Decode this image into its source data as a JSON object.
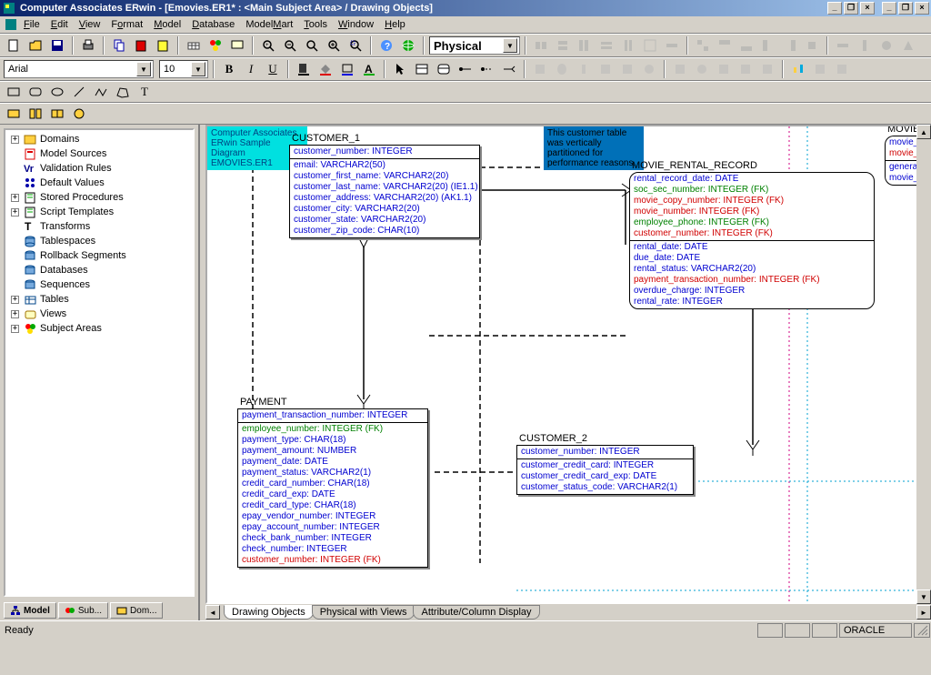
{
  "title": "Computer Associates ERwin - [Emovies.ER1* : <Main Subject Area> / Drawing Objects]",
  "menu": [
    "File",
    "Edit",
    "View",
    "Format",
    "Model",
    "Database",
    "ModelMart",
    "Tools",
    "Window",
    "Help"
  ],
  "font_combo": "Arial",
  "size_combo": "10",
  "model_level": "Physical",
  "tree": [
    {
      "exp": "+",
      "label": "Domains"
    },
    {
      "exp": "",
      "label": "Model Sources"
    },
    {
      "exp": "",
      "label": "Validation Rules"
    },
    {
      "exp": "",
      "label": "Default Values"
    },
    {
      "exp": "+",
      "label": "Stored Procedures"
    },
    {
      "exp": "+",
      "label": "Script Templates"
    },
    {
      "exp": "",
      "label": "Transforms"
    },
    {
      "exp": "",
      "label": "Tablespaces"
    },
    {
      "exp": "",
      "label": "Rollback Segments"
    },
    {
      "exp": "",
      "label": "Databases"
    },
    {
      "exp": "",
      "label": "Sequences"
    },
    {
      "exp": "+",
      "label": "Tables"
    },
    {
      "exp": "+",
      "label": "Views"
    },
    {
      "exp": "+",
      "label": "Subject Areas"
    }
  ],
  "sidebar_tabs": {
    "t1": "Model",
    "t2": "Sub...",
    "t3": "Dom..."
  },
  "canvas_tabs": {
    "t1": "Drawing Objects",
    "t2": "Physical with Views",
    "t3": "Attribute/Column Display"
  },
  "note1_line1": "Computer Associates",
  "note1_line2": "ERwin Sample",
  "note1_line3": "Diagram",
  "note1_line4": "EMOVIES.ER1",
  "note2_line1": "This customer table",
  "note2_line2": "was vertically",
  "note2_line3": "partitioned for",
  "note2_line4": "performance reasons.",
  "entities": {
    "customer1": {
      "name": "CUSTOMER_1",
      "pk": [
        {
          "t": "customer_number: INTEGER",
          "c": "c-blue"
        }
      ],
      "cols": [
        {
          "t": "email: VARCHAR2(50)",
          "c": "c-blue"
        },
        {
          "t": "customer_first_name: VARCHAR2(20)",
          "c": "c-blue"
        },
        {
          "t": "customer_last_name: VARCHAR2(20) (IE1.1)",
          "c": "c-blue"
        },
        {
          "t": "customer_address: VARCHAR2(20) (AK1.1)",
          "c": "c-blue"
        },
        {
          "t": "customer_city: VARCHAR2(20)",
          "c": "c-blue"
        },
        {
          "t": "customer_state: VARCHAR2(20)",
          "c": "c-blue"
        },
        {
          "t": "customer_zip_code: CHAR(10)",
          "c": "c-blue"
        }
      ]
    },
    "movie_rental": {
      "name": "MOVIE_RENTAL_RECORD",
      "pk": [
        {
          "t": "rental_record_date: DATE",
          "c": "c-blue"
        },
        {
          "t": "soc_sec_number: INTEGER (FK)",
          "c": "c-green"
        },
        {
          "t": "movie_copy_number: INTEGER (FK)",
          "c": "c-red"
        },
        {
          "t": "movie_number: INTEGER (FK)",
          "c": "c-red"
        },
        {
          "t": "employee_phone: INTEGER (FK)",
          "c": "c-green"
        },
        {
          "t": "customer_number: INTEGER (FK)",
          "c": "c-red"
        }
      ],
      "cols": [
        {
          "t": "rental_date: DATE",
          "c": "c-blue"
        },
        {
          "t": "due_date: DATE",
          "c": "c-blue"
        },
        {
          "t": "rental_status: VARCHAR2(20)",
          "c": "c-blue"
        },
        {
          "t": "payment_transaction_number: INTEGER (FK)",
          "c": "c-red"
        },
        {
          "t": "overdue_charge: INTEGER",
          "c": "c-blue"
        },
        {
          "t": "rental_rate: INTEGER",
          "c": "c-blue"
        }
      ]
    },
    "payment": {
      "name": "PAYMENT",
      "pk": [
        {
          "t": "payment_transaction_number: INTEGER",
          "c": "c-blue"
        }
      ],
      "cols": [
        {
          "t": "employee_number: INTEGER (FK)",
          "c": "c-green"
        },
        {
          "t": "payment_type: CHAR(18)",
          "c": "c-blue"
        },
        {
          "t": "payment_amount: NUMBER",
          "c": "c-blue"
        },
        {
          "t": "payment_date: DATE",
          "c": "c-blue"
        },
        {
          "t": "payment_status: VARCHAR2(1)",
          "c": "c-blue"
        },
        {
          "t": "credit_card_number: CHAR(18)",
          "c": "c-blue"
        },
        {
          "t": "credit_card_exp: DATE",
          "c": "c-blue"
        },
        {
          "t": "credit_card_type: CHAR(18)",
          "c": "c-blue"
        },
        {
          "t": "epay_vendor_number: INTEGER",
          "c": "c-blue"
        },
        {
          "t": "epay_account_number: INTEGER",
          "c": "c-blue"
        },
        {
          "t": "check_bank_number: INTEGER",
          "c": "c-blue"
        },
        {
          "t": "check_number: INTEGER",
          "c": "c-blue"
        },
        {
          "t": "customer_number: INTEGER (FK)",
          "c": "c-red"
        }
      ]
    },
    "customer2": {
      "name": "CUSTOMER_2",
      "pk": [
        {
          "t": "customer_number: INTEGER",
          "c": "c-blue"
        }
      ],
      "cols": [
        {
          "t": "customer_credit_card: INTEGER",
          "c": "c-blue"
        },
        {
          "t": "customer_credit_card_exp: DATE",
          "c": "c-blue"
        },
        {
          "t": "customer_status_code: VARCHAR2(1)",
          "c": "c-blue"
        }
      ]
    },
    "movie_c": {
      "name": "MOVIE_C",
      "pk": [
        {
          "t": "movie_c",
          "c": "c-blue"
        },
        {
          "t": "movie_n",
          "c": "c-red"
        }
      ],
      "cols": [
        {
          "t": "general_",
          "c": "c-blue"
        },
        {
          "t": "movie_fo",
          "c": "c-blue"
        }
      ]
    }
  },
  "status_ready": "Ready",
  "status_db": "ORACLE"
}
